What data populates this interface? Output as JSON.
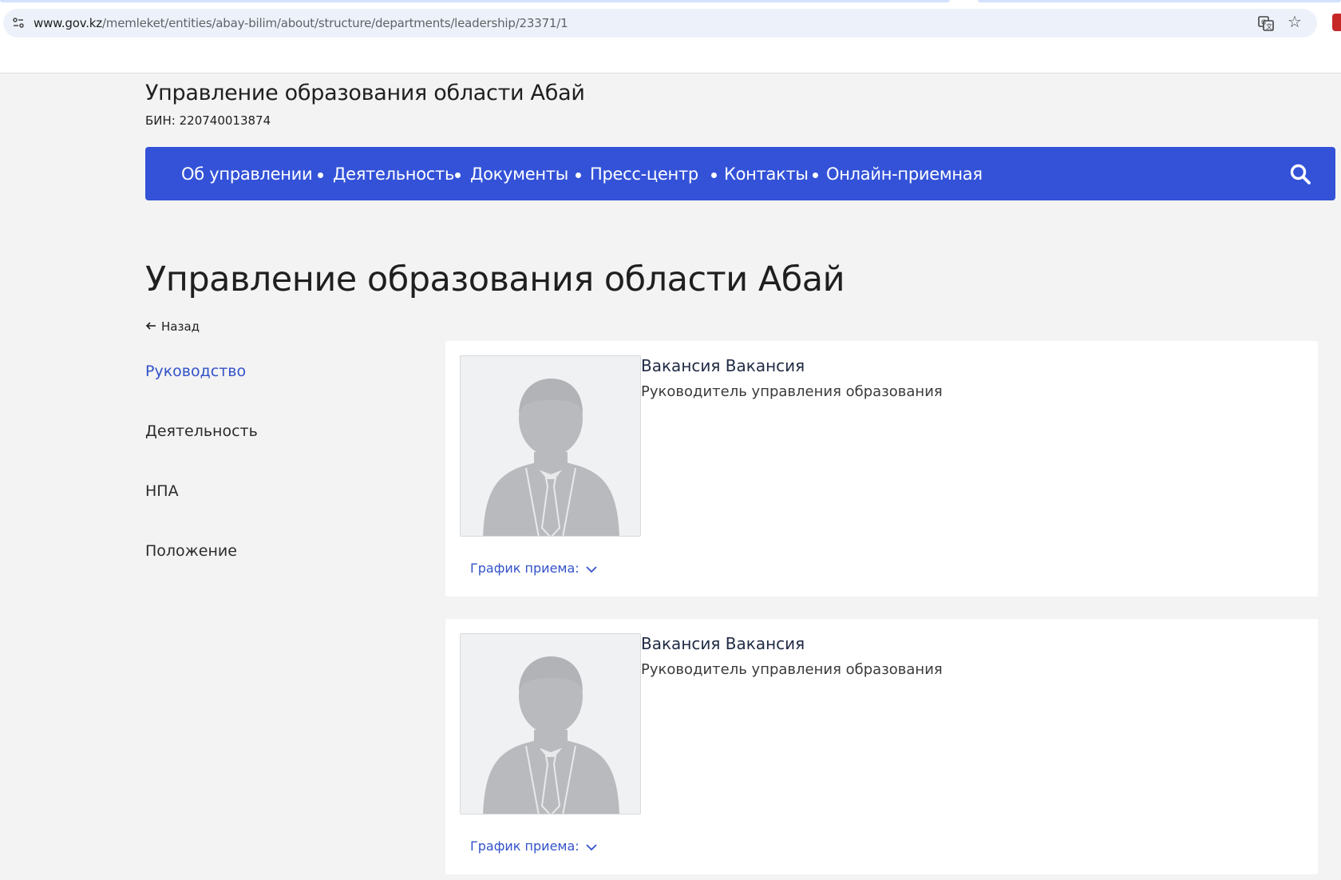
{
  "browser": {
    "url_host": "www.gov.kz",
    "url_path": "/memleket/entities/abay-bilim/about/structure/departments/leadership/23371/1",
    "icons": [
      "site-info-icon",
      "translate-icon",
      "star-icon",
      "extension-icon"
    ]
  },
  "header": {
    "org_title": "Управление образования области Абай",
    "bin": "БИН: 220740013874"
  },
  "nav": {
    "items": [
      {
        "label": "Об управлении"
      },
      {
        "label": "Деятельность"
      },
      {
        "label": "Документы"
      },
      {
        "label": "Пресс-центр"
      },
      {
        "label": "Контакты"
      },
      {
        "label": "Онлайн-приемная"
      }
    ],
    "search_icon": "search-icon",
    "color": "#3352d8"
  },
  "main": {
    "title": "Управление образования области Абай",
    "back_label": "Назад"
  },
  "sidebar": {
    "items": [
      {
        "label": "Руководство",
        "active": true
      },
      {
        "label": "Деятельность",
        "active": false
      },
      {
        "label": "НПА",
        "active": false
      },
      {
        "label": "Положение",
        "active": false
      }
    ],
    "active_color": "#3352c8"
  },
  "leaders": [
    {
      "name": "Вакансия Вакансия",
      "position": "Руководитель управления образования",
      "schedule_label": "График приема:",
      "photo_icon": "person-placeholder-icon"
    },
    {
      "name": "Вакансия Вакансия",
      "position": "Руководитель управления образования",
      "schedule_label": "График приема:",
      "photo_icon": "person-placeholder-icon"
    }
  ]
}
